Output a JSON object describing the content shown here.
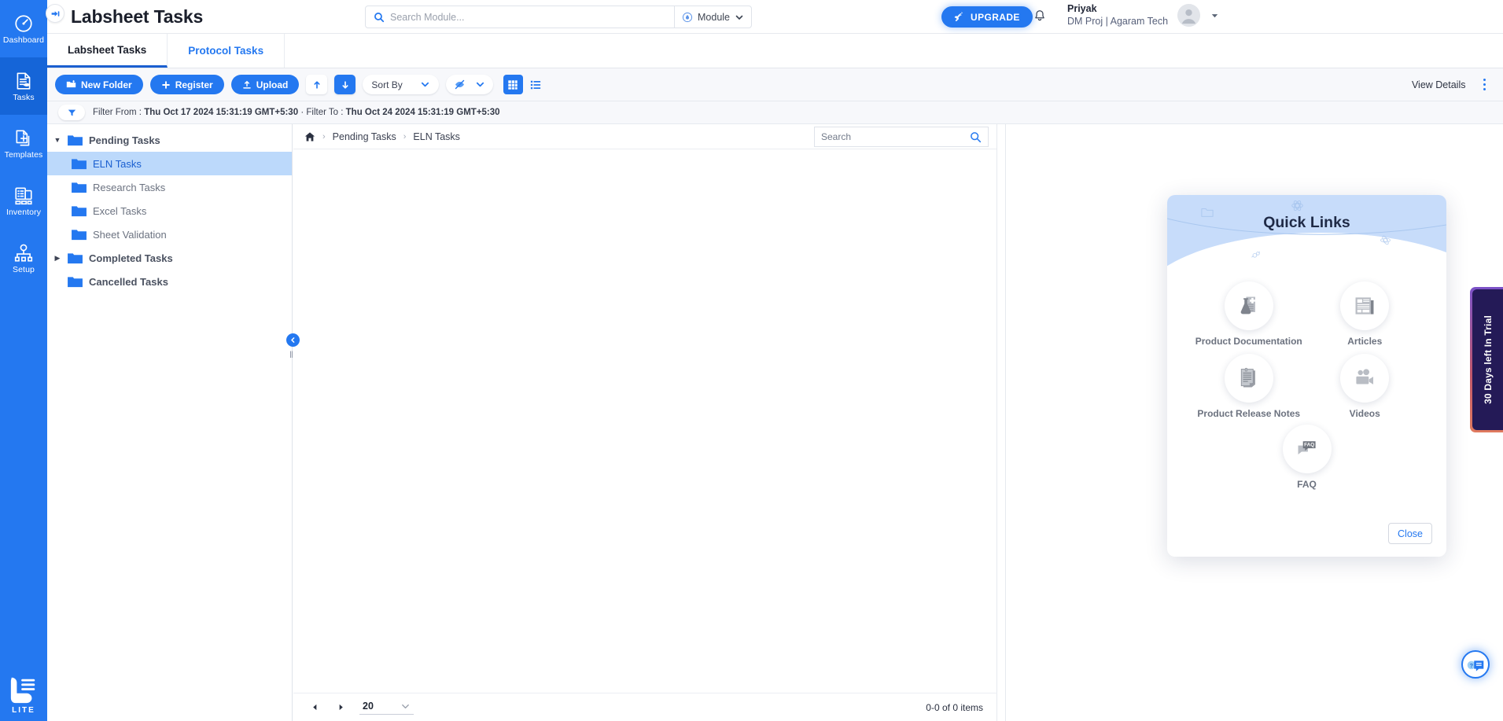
{
  "app": {
    "page_title": "Labsheet Tasks"
  },
  "rail": {
    "items": [
      {
        "label": "Dashboard",
        "icon": "dashboard-icon",
        "active": false
      },
      {
        "label": "Tasks",
        "icon": "tasks-icon",
        "active": true
      },
      {
        "label": "Templates",
        "icon": "templates-icon",
        "active": false
      },
      {
        "label": "Inventory",
        "icon": "inventory-icon",
        "active": false
      },
      {
        "label": "Setup",
        "icon": "setup-icon",
        "active": false
      }
    ],
    "logo_text": "LITE"
  },
  "header": {
    "pin_icon": "pin-icon",
    "search": {
      "placeholder": "Search Module...",
      "value": "",
      "icon": "search-icon"
    },
    "module_selector": {
      "label": "Module",
      "icon": "flask-icon",
      "caret": "chevron-down-icon"
    },
    "upgrade_button": {
      "label": "UPGRADE",
      "icon": "rocket-icon"
    },
    "notification_icon": "bell-icon",
    "user": {
      "name": "Priyak",
      "org": "DM Proj | Agaram Tech",
      "avatar": "user-avatar-icon",
      "caret": "chevron-down-icon"
    }
  },
  "tabs": [
    {
      "label": "Labsheet Tasks",
      "active": true
    },
    {
      "label": "Protocol Tasks",
      "active": false
    }
  ],
  "toolbar": {
    "new_folder": {
      "label": "New Folder",
      "icon": "folder-plus-icon"
    },
    "register": {
      "label": "Register",
      "icon": "plus-icon"
    },
    "upload": {
      "label": "Upload",
      "icon": "upload-icon"
    },
    "sort_asc_icon": "arrow-up-icon",
    "sort_desc_icon": "arrow-down-icon",
    "sort_by": {
      "label": "Sort By",
      "caret": "chevron-down-icon"
    },
    "visibility": {
      "icon": "eye-off-icon",
      "caret": "chevron-down-icon"
    },
    "grid_view_icon": "grid-view-icon",
    "list_view_icon": "list-view-icon",
    "view_details": "View Details",
    "more_icon": "kebab-menu-icon"
  },
  "filter": {
    "icon": "filter-icon",
    "from_label": "Filter From :",
    "from_value": "Thu Oct 17 2024 15:31:19 GMT+5:30",
    "separator": "·",
    "to_label": "Filter To :",
    "to_value": "Thu Oct 24 2024 15:31:19 GMT+5:30"
  },
  "tree": {
    "nodes": [
      {
        "label": "Pending Tasks",
        "level": "root",
        "expanded": true,
        "selected": false,
        "twisty": "▼"
      },
      {
        "label": "ELN Tasks",
        "level": "child",
        "expanded": false,
        "selected": true,
        "twisty": ""
      },
      {
        "label": "Research Tasks",
        "level": "child",
        "expanded": false,
        "selected": false,
        "twisty": ""
      },
      {
        "label": "Excel Tasks",
        "level": "child",
        "expanded": false,
        "selected": false,
        "twisty": ""
      },
      {
        "label": "Sheet Validation",
        "level": "child",
        "expanded": false,
        "selected": false,
        "twisty": ""
      },
      {
        "label": "Completed Tasks",
        "level": "root",
        "expanded": false,
        "selected": false,
        "twisty": "▶"
      },
      {
        "label": "Cancelled Tasks",
        "level": "root",
        "expanded": false,
        "selected": false,
        "twisty": ""
      }
    ],
    "collapse_icon": "chevron-left-icon",
    "resize_handle": "‖"
  },
  "main": {
    "breadcrumb": {
      "home_icon": "home-icon",
      "items": [
        "Pending Tasks",
        "ELN Tasks"
      ],
      "separator": "›"
    },
    "search": {
      "placeholder": "Search",
      "value": "",
      "icon": "search-icon"
    },
    "pager": {
      "prev_icon": "triangle-left-icon",
      "next_icon": "triangle-right-icon",
      "page_size": "20",
      "page_size_caret": "chevron-down-icon",
      "count_text": "0-0 of 0 items"
    }
  },
  "quick_links": {
    "title": "Quick Links",
    "items": [
      {
        "label": "Product Documentation",
        "icon": "product-documentation-icon"
      },
      {
        "label": "Articles",
        "icon": "articles-icon"
      },
      {
        "label": "Product Release Notes",
        "icon": "release-notes-icon"
      },
      {
        "label": "Videos",
        "icon": "videos-icon"
      }
    ],
    "faq": {
      "label": "FAQ",
      "icon": "faq-icon",
      "badge": "FAQ"
    },
    "close_label": "Close"
  },
  "trial_banner": {
    "text": "30 Days left In Trial"
  },
  "help_fab": {
    "icon": "help-chat-icon"
  },
  "colors": {
    "brand_blue": "#2478f0",
    "rail_blue": "#2478f0",
    "rail_active": "#1565d8",
    "selected_row": "#bcd9fb",
    "quick_links_header": "#c7dcfa",
    "trial_navy": "#241a57",
    "toolbar_bg": "#f7f8fb"
  }
}
